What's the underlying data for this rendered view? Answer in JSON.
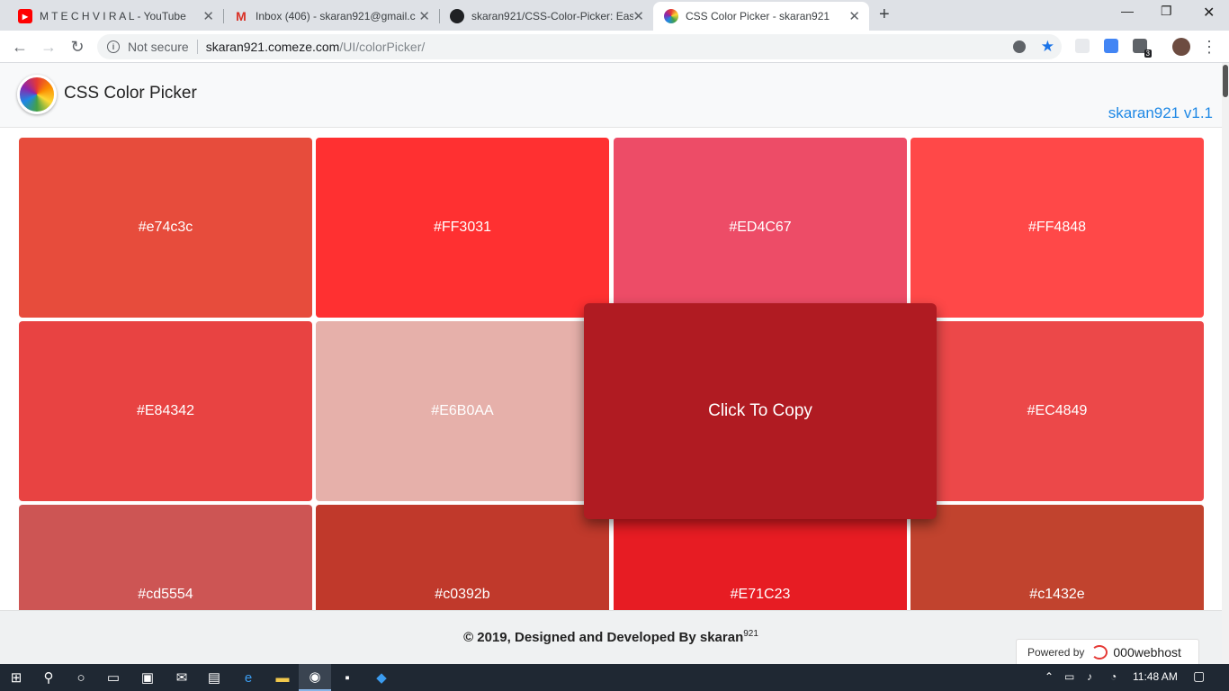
{
  "browser": {
    "tabs": [
      {
        "title": "M T E C H V I R A L - YouTube",
        "icon": "youtube-icon",
        "color": "#ff0000"
      },
      {
        "title": "Inbox (406) - skaran921@gmail.c",
        "icon": "gmail-icon",
        "color": "#d93025"
      },
      {
        "title": "skaran921/CSS-Color-Picker: Eas",
        "icon": "github-icon",
        "color": "#202124"
      },
      {
        "title": "CSS Color Picker - skaran921",
        "icon": "color-wheel-icon",
        "color": "#1e88e5"
      }
    ],
    "address": {
      "security_label": "Not secure",
      "url_host": "skaran921.comeze.com",
      "url_path": "/UI/colorPicker/"
    },
    "extension_badge": "3"
  },
  "app": {
    "title": "CSS Color Picker",
    "version_link": "skaran921 v1.1"
  },
  "swatches": [
    {
      "label": "#e74c3c",
      "color": "#e74c3c"
    },
    {
      "label": "#FF3031",
      "color": "#FF3031"
    },
    {
      "label": "#ED4C67",
      "color": "#ED4C67"
    },
    {
      "label": "#FF4848",
      "color": "#FF4848"
    },
    {
      "label": "#E84342",
      "color": "#E84342"
    },
    {
      "label": "#E6B0AA",
      "color": "#E6B0AA"
    },
    {
      "label": "",
      "color": "#b01b22"
    },
    {
      "label": "#EC4849",
      "color": "#EC4849"
    },
    {
      "label": "#cd5554",
      "color": "#cd5554"
    },
    {
      "label": "#c0392b",
      "color": "#c0392b"
    },
    {
      "label": "#E71C23",
      "color": "#E71C23"
    },
    {
      "label": "#c1432e",
      "color": "#c1432e"
    }
  ],
  "popup": {
    "label": "Click To Copy",
    "color": "#b01b22"
  },
  "footer": {
    "copyright": "© 2019, Designed and Developed By skaran",
    "copyright_sup": "921",
    "powered_label": "Powered by",
    "host_name": "000webhost"
  },
  "taskbar": {
    "time": "11:48 AM"
  }
}
